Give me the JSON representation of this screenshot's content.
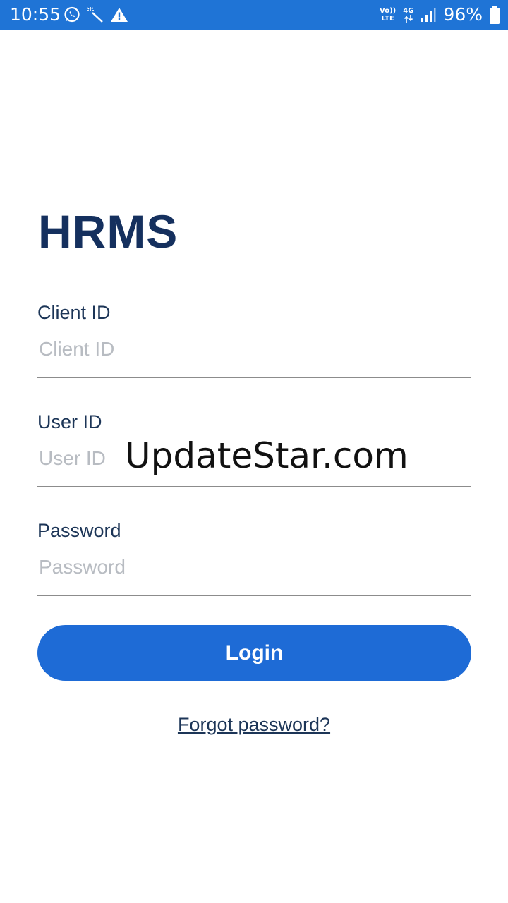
{
  "status_bar": {
    "time": "10:55",
    "volte_label": "Vo))",
    "lte_label": "LTE",
    "network_label": "4G",
    "battery_percent": "96%",
    "icons": [
      "whatsapp-icon",
      "magic-wand-icon",
      "warning-icon",
      "volte-icon",
      "data-arrows-icon",
      "signal-icon",
      "battery-icon"
    ],
    "background_color": "#1f74d6"
  },
  "app": {
    "title": "HRMS",
    "title_color": "#15305e"
  },
  "form": {
    "client_id": {
      "label": "Client ID",
      "placeholder": "Client ID",
      "value": ""
    },
    "user_id": {
      "label": "User ID",
      "placeholder": "User ID",
      "value": ""
    },
    "password": {
      "label": "Password",
      "placeholder": "Password",
      "value": ""
    },
    "login_label": "Login",
    "login_color": "#1e6bd6",
    "forgot_password_label": "Forgot password?"
  },
  "watermark": "UpdateStar.com"
}
